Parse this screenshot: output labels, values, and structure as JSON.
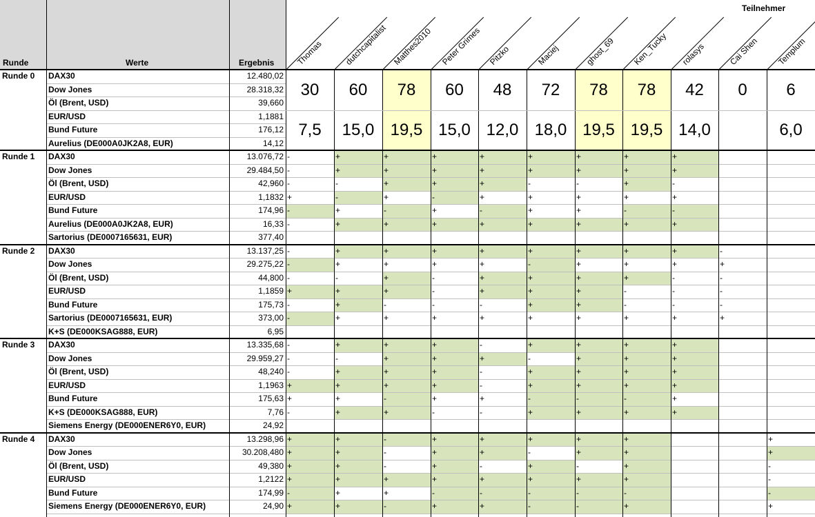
{
  "header": {
    "runde": "Runde",
    "werte": "Werte",
    "ergebnis": "Ergebnis",
    "teilnehmer": "Teilnehmer"
  },
  "participants": [
    "Thomas",
    "dutchcapitalist",
    "Matthes2010",
    "Peter Grimes",
    "Pitzko",
    "Maciej",
    "ghost_69",
    "Ken_Tucky",
    "rolasys",
    "Cai Shen",
    "Templum"
  ],
  "colors": {
    "highlight": "#ffffcc",
    "correct": "#d8e4bc",
    "header": "#d9d9d9"
  },
  "totals": {
    "points": [
      "30",
      "60",
      "78",
      "60",
      "48",
      "72",
      "78",
      "78",
      "42",
      "0",
      "6"
    ],
    "scores": [
      "7,5",
      "15,0",
      "19,5",
      "15,0",
      "12,0",
      "18,0",
      "19,5",
      "19,5",
      "14,0",
      "",
      "6,0"
    ],
    "highlighted": [
      false,
      false,
      true,
      false,
      false,
      false,
      true,
      true,
      false,
      false,
      false
    ]
  },
  "rounds": [
    {
      "label": "Runde 0",
      "rows": [
        {
          "wert": "DAX30",
          "ergebnis": "12.480,02"
        },
        {
          "wert": "Dow Jones",
          "ergebnis": "28.318,32"
        },
        {
          "wert": "Öl (Brent, USD)",
          "ergebnis": "39,660"
        },
        {
          "wert": "EUR/USD",
          "ergebnis": "1,1881"
        },
        {
          "wert": "Bund Future",
          "ergebnis": "176,12"
        },
        {
          "wert": "Aurelius (DE000A0JK2A8, EUR)",
          "ergebnis": "14,12"
        }
      ]
    },
    {
      "label": "Runde 1",
      "rows": [
        {
          "wert": "DAX30",
          "ergebnis": "13.076,72",
          "cells": [
            "-",
            "+",
            "+",
            "+",
            "+",
            "+",
            "+",
            "+",
            "+",
            "",
            ""
          ],
          "green": [
            0,
            1,
            1,
            1,
            1,
            1,
            1,
            1,
            1,
            0,
            0
          ]
        },
        {
          "wert": "Dow Jones",
          "ergebnis": "29.484,50",
          "cells": [
            "-",
            "+",
            "+",
            "+",
            "+",
            "+",
            "+",
            "+",
            "+",
            "",
            ""
          ],
          "green": [
            0,
            1,
            1,
            1,
            1,
            1,
            1,
            1,
            1,
            0,
            0
          ]
        },
        {
          "wert": "Öl (Brent, USD)",
          "ergebnis": "42,960",
          "cells": [
            "-",
            "-",
            "+",
            "+",
            "+",
            "-",
            "-",
            "+",
            "-",
            "",
            ""
          ],
          "green": [
            0,
            0,
            1,
            1,
            1,
            0,
            0,
            1,
            0,
            0,
            0
          ]
        },
        {
          "wert": "EUR/USD",
          "ergebnis": "1,1832",
          "cells": [
            "+",
            "-",
            "+",
            "-",
            "+",
            "+",
            "+",
            "+",
            "+",
            "",
            ""
          ],
          "green": [
            0,
            1,
            0,
            1,
            0,
            0,
            0,
            0,
            0,
            0,
            0
          ]
        },
        {
          "wert": "Bund Future",
          "ergebnis": "174,96",
          "cells": [
            "-",
            "+",
            "-",
            "+",
            "-",
            "+",
            "+",
            "-",
            "-",
            "",
            ""
          ],
          "green": [
            1,
            0,
            1,
            0,
            1,
            0,
            0,
            1,
            1,
            0,
            0
          ]
        },
        {
          "wert": "Aurelius (DE000A0JK2A8, EUR)",
          "ergebnis": "16,33",
          "cells": [
            "-",
            "+",
            "+",
            "+",
            "+",
            "+",
            "+",
            "+",
            "+",
            "",
            ""
          ],
          "green": [
            0,
            1,
            1,
            1,
            1,
            1,
            1,
            1,
            1,
            0,
            0
          ]
        },
        {
          "wert": "Sartorius (DE0007165631, EUR)",
          "ergebnis": "377,40",
          "empty": true
        }
      ]
    },
    {
      "label": "Runde 2",
      "rows": [
        {
          "wert": "DAX30",
          "ergebnis": "13.137,25",
          "cells": [
            "-",
            "+",
            "+",
            "+",
            "+",
            "+",
            "+",
            "+",
            "+",
            "-",
            ""
          ],
          "green": [
            0,
            1,
            1,
            1,
            1,
            1,
            1,
            1,
            1,
            0,
            0
          ]
        },
        {
          "wert": "Dow Jones",
          "ergebnis": "29.275,22",
          "cells": [
            "-",
            "+",
            "+",
            "+",
            "+",
            "-",
            "+",
            "+",
            "+",
            "+",
            ""
          ],
          "green": [
            1,
            0,
            0,
            0,
            0,
            1,
            0,
            0,
            0,
            0,
            0
          ]
        },
        {
          "wert": "Öl (Brent, USD)",
          "ergebnis": "44,800",
          "cells": [
            "-",
            "-",
            "+",
            "-",
            "+",
            "+",
            "+",
            "+",
            "-",
            "-",
            ""
          ],
          "green": [
            0,
            0,
            1,
            0,
            1,
            1,
            1,
            1,
            0,
            0,
            0
          ]
        },
        {
          "wert": "EUR/USD",
          "ergebnis": "1,1859",
          "cells": [
            "+",
            "+",
            "+",
            "-",
            "+",
            "+",
            "+",
            "-",
            "-",
            "-",
            ""
          ],
          "green": [
            1,
            1,
            1,
            0,
            1,
            1,
            1,
            0,
            0,
            0,
            0
          ]
        },
        {
          "wert": "Bund Future",
          "ergebnis": "175,73",
          "cells": [
            "-",
            "+",
            "-",
            "-",
            "-",
            "+",
            "+",
            "-",
            "-",
            "-",
            ""
          ],
          "green": [
            0,
            1,
            0,
            0,
            0,
            1,
            1,
            0,
            0,
            0,
            0
          ]
        },
        {
          "wert": "Sartorius (DE0007165631, EUR)",
          "ergebnis": "373,00",
          "cells": [
            "-",
            "+",
            "+",
            "+",
            "+",
            "+",
            "+",
            "+",
            "+",
            "+",
            ""
          ],
          "green": [
            1,
            0,
            0,
            0,
            0,
            0,
            0,
            0,
            0,
            0,
            0
          ]
        },
        {
          "wert": "K+S (DE000KSAG888, EUR)",
          "ergebnis": "6,95",
          "empty": true
        }
      ]
    },
    {
      "label": "Runde 3",
      "rows": [
        {
          "wert": "DAX30",
          "ergebnis": "13.335,68",
          "cells": [
            "-",
            "+",
            "+",
            "+",
            "-",
            "+",
            "+",
            "+",
            "+",
            "",
            ""
          ],
          "green": [
            0,
            1,
            1,
            1,
            0,
            1,
            1,
            1,
            1,
            0,
            0
          ]
        },
        {
          "wert": "Dow Jones",
          "ergebnis": "29.959,27",
          "cells": [
            "-",
            "-",
            "+",
            "+",
            "+",
            "-",
            "+",
            "+",
            "+",
            "",
            ""
          ],
          "green": [
            0,
            0,
            1,
            1,
            1,
            0,
            1,
            1,
            1,
            0,
            0
          ]
        },
        {
          "wert": "Öl (Brent, USD)",
          "ergebnis": "48,240",
          "cells": [
            "-",
            "+",
            "+",
            "+",
            "-",
            "+",
            "+",
            "+",
            "+",
            "",
            ""
          ],
          "green": [
            0,
            1,
            1,
            1,
            0,
            1,
            1,
            1,
            1,
            0,
            0
          ]
        },
        {
          "wert": "EUR/USD",
          "ergebnis": "1,1963",
          "cells": [
            "+",
            "+",
            "+",
            "+",
            "-",
            "+",
            "+",
            "+",
            "+",
            "",
            ""
          ],
          "green": [
            1,
            1,
            1,
            1,
            0,
            1,
            1,
            1,
            1,
            0,
            0
          ]
        },
        {
          "wert": "Bund Future",
          "ergebnis": "175,63",
          "cells": [
            "+",
            "+",
            "-",
            "+",
            "+",
            "-",
            "-",
            "-",
            "+",
            "",
            ""
          ],
          "green": [
            0,
            0,
            1,
            0,
            0,
            1,
            1,
            1,
            0,
            0,
            0
          ]
        },
        {
          "wert": "K+S (DE000KSAG888, EUR)",
          "ergebnis": "7,76",
          "cells": [
            "-",
            "+",
            "+",
            "-",
            "-",
            "+",
            "+",
            "+",
            "+",
            "",
            ""
          ],
          "green": [
            0,
            1,
            1,
            0,
            0,
            1,
            1,
            1,
            1,
            0,
            0
          ]
        },
        {
          "wert": "Siemens Energy (DE000ENER6Y0, EUR)",
          "ergebnis": "24,92",
          "empty": true
        }
      ]
    },
    {
      "label": "Runde 4",
      "rows": [
        {
          "wert": "DAX30",
          "ergebnis": "13.298,96",
          "cells": [
            "+",
            "+",
            "-",
            "+",
            "+",
            "+",
            "+",
            "+",
            "",
            "",
            "+"
          ],
          "green": [
            1,
            1,
            1,
            1,
            1,
            1,
            1,
            1,
            0,
            0,
            0
          ]
        },
        {
          "wert": "Dow Jones",
          "ergebnis": "30.208,480",
          "cells": [
            "+",
            "+",
            "-",
            "+",
            "+",
            "-",
            "+",
            "+",
            "",
            "",
            "+"
          ],
          "green": [
            1,
            1,
            0,
            1,
            1,
            0,
            1,
            1,
            0,
            0,
            1
          ]
        },
        {
          "wert": "Öl (Brent, USD)",
          "ergebnis": "49,380",
          "cells": [
            "+",
            "+",
            "-",
            "+",
            "-",
            "+",
            "-",
            "+",
            "",
            "",
            "-"
          ],
          "green": [
            1,
            1,
            0,
            1,
            0,
            1,
            0,
            1,
            0,
            0,
            0
          ]
        },
        {
          "wert": "EUR/USD",
          "ergebnis": "1,2122",
          "cells": [
            "+",
            "+",
            "+",
            "+",
            "+",
            "+",
            "+",
            "+",
            "",
            "",
            "-"
          ],
          "green": [
            1,
            1,
            1,
            1,
            1,
            1,
            1,
            1,
            0,
            0,
            0
          ]
        },
        {
          "wert": "Bund Future",
          "ergebnis": "174,99",
          "cells": [
            "-",
            "+",
            "+",
            "-",
            "-",
            "-",
            "-",
            "-",
            "",
            "",
            "-"
          ],
          "green": [
            1,
            0,
            0,
            1,
            1,
            1,
            1,
            1,
            0,
            0,
            1
          ]
        },
        {
          "wert": "Siemens Energy (DE000ENER6Y0, EUR)",
          "ergebnis": "24,90",
          "cells": [
            "+",
            "+",
            "-",
            "+",
            "+",
            "-",
            "-",
            "+",
            "",
            "",
            "+"
          ],
          "green": [
            1,
            1,
            1,
            1,
            1,
            1,
            1,
            1,
            0,
            0,
            0
          ]
        }
      ]
    }
  ]
}
